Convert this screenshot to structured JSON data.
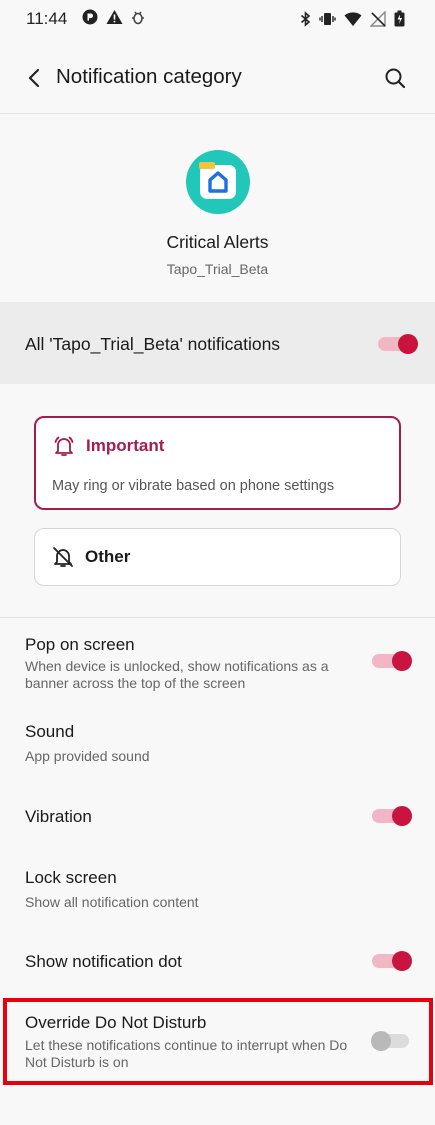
{
  "status_bar": {
    "time": "11:44",
    "left_icons": [
      "app-notification-icon",
      "warning-icon",
      "bug-icon"
    ],
    "right_icons": [
      "bluetooth-icon",
      "vibrate-icon",
      "wifi-icon",
      "no-signal-icon",
      "battery-icon"
    ]
  },
  "app_bar": {
    "title": "Notification category",
    "back_icon": "back-arrow-icon",
    "search_icon": "search-icon"
  },
  "header": {
    "channel_name": "Critical Alerts",
    "app_name": "Tapo_Trial_Beta",
    "app_icon_color": "#21c7b8"
  },
  "master_toggle": {
    "label": "All 'Tapo_Trial_Beta' notifications",
    "on": true
  },
  "importance": {
    "important": {
      "title": "Important",
      "description": "May ring or vibrate based on phone settings",
      "selected": true,
      "icon": "bell-ringing-icon"
    },
    "other": {
      "title": "Other",
      "selected": false,
      "icon": "bell-off-icon"
    }
  },
  "settings": [
    {
      "title": "Pop on screen",
      "subtitle": "When device is unlocked, show notifications as a banner across the top of the screen",
      "toggle": true
    },
    {
      "title": "Sound",
      "subtitle": "App provided sound"
    },
    {
      "title": "Vibration",
      "subtitle": "",
      "toggle": true
    },
    {
      "title": "Lock screen",
      "subtitle": "Show all notification content"
    },
    {
      "title": "Show notification dot",
      "subtitle": "",
      "toggle": true
    },
    {
      "title": "Override Do Not Disturb",
      "subtitle": "Let these notifications continue to interrupt when Do Not Disturb is on",
      "toggle": false
    }
  ],
  "colors": {
    "accent": "#c8143f",
    "accent_track": "#f2b7c4",
    "important_border": "#a51c4f",
    "highlight": "#e8000c"
  }
}
